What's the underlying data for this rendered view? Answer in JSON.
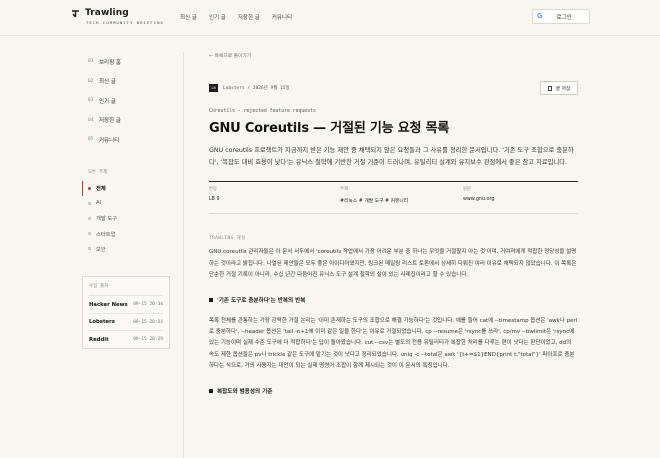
{
  "header": {
    "logo_title": "Trawling",
    "logo_sub": "TECH COMMUNITY BRIEFING",
    "nav": [
      "최신 글",
      "인기 글",
      "저장한 글",
      "커뮤니티"
    ],
    "login_label": "로그인",
    "google_letter": "G"
  },
  "sidebar": {
    "items": [
      {
        "num": "01",
        "label": "브리핑 홈"
      },
      {
        "num": "02",
        "label": "최신 글"
      },
      {
        "num": "03",
        "label": "인기 글"
      },
      {
        "num": "04",
        "label": "저장한 글"
      },
      {
        "num": "05",
        "label": "커뮤니티"
      }
    ],
    "topics_label": "모든 주제",
    "topics": [
      "전체",
      "AI",
      "개발 도구",
      "스타트업",
      "보안"
    ],
    "feed_title": "수집 출처",
    "feeds": [
      {
        "name": "Hacker News",
        "time": "09-15 20:34"
      },
      {
        "name": "Lobsters",
        "time": "09-15 20:34"
      },
      {
        "name": "Reddit",
        "time": "09-15 20:29"
      }
    ]
  },
  "article": {
    "back": "← 목록으로 돌아가기",
    "badge": "LB",
    "meta": "Lobsters  /  2026년 9월 15일",
    "save_label": "글 저장",
    "kicker": "Coreutils - rejected feature requests",
    "title": "GNU Coreutils — 거절된 기능 요청 목록",
    "lead": "GNU coreutils 프로젝트가 지금까지 받은 기능 제안 중 채택되지 않은 요청들과 그 사유를 정리한 문서입니다. '기존 도구 조합으로 충분하다', '복잡도 대비 효용이 낮다'는 유닉스 철학에 기반한 거절 기준이 드러나며, 유틸리티 설계와 유지보수 관점에서 좋은 참고 자료입니다.",
    "info": [
      {
        "key": "반응",
        "value": "LB 9"
      },
      {
        "key": "주제",
        "value": "#리눅스 # 개발 도구 # 커뮤니티"
      },
      {
        "key": "원문",
        "value": "www.gnu.org"
      }
    ],
    "section_label": "TRAWLING 해설",
    "para1": "GNU coreutils 관리자들은 이 문서 서두에서 'coreutils 작업에서 가장 어려운 부분 중 하나는 무엇을 거절할지 아는 것'이며, 거여져에게 적합한 정당성을 설명하는 것이라고 밝힙니다. 나열된 제안들은 모두 좋은 아이디어였지만, 링크된 메일링 리스트 토론에서 상세히 다뤄진 여러 이유로 채택되지 않았습니다. 이 목록은 단순한 거절 기록이 아니라, 수십 년간 다듬어진 유닉스 도구 설계 철학의 살아 있는 사례집이라고 할 수 있습니다.",
    "heading1": "'기존 도구로 충분하다'는 반복의 반복",
    "para2": "목록 전체를 관통하는 가장 강력한 거절 논리는 '이미 존재하는 도구의 조합으로 해결 가능하다'는 것입니다. 예를 들어 cat에 --timestamp 옵션은 'awk나 perl로 충분하다', --header 옵션은 'tail -n+1에 이미 같은 일을 한다'는 이유로 거절되었습니다. cp --resume은 'rsync를 쓰라', cp/mv --bwlimit은 'rsync에 있는 기능이며 실제 수준 도구에 더 적합하다'는 답이 돌아왔습니다. cut --csv는 별도의 전용 유틸리티가 복잡한 처리를 다루는 편이 낫다는 판단이었고, dd의 속도 제한 옵션들은 pv나 trickle 같은 도구에 맡기는 것이 낫다고 정리되었습니다. uniq -c --total은 awk '{t+=$1}END{print t,\"total\"}' 파이프로 충분하다는 식으로, 거의 사용자는 대안이 되는 실제 명령어 조합이 함께 제시되는 것이 이 문서의 특징입니다.",
    "heading2": "복잡도와 범용성의 기준"
  }
}
